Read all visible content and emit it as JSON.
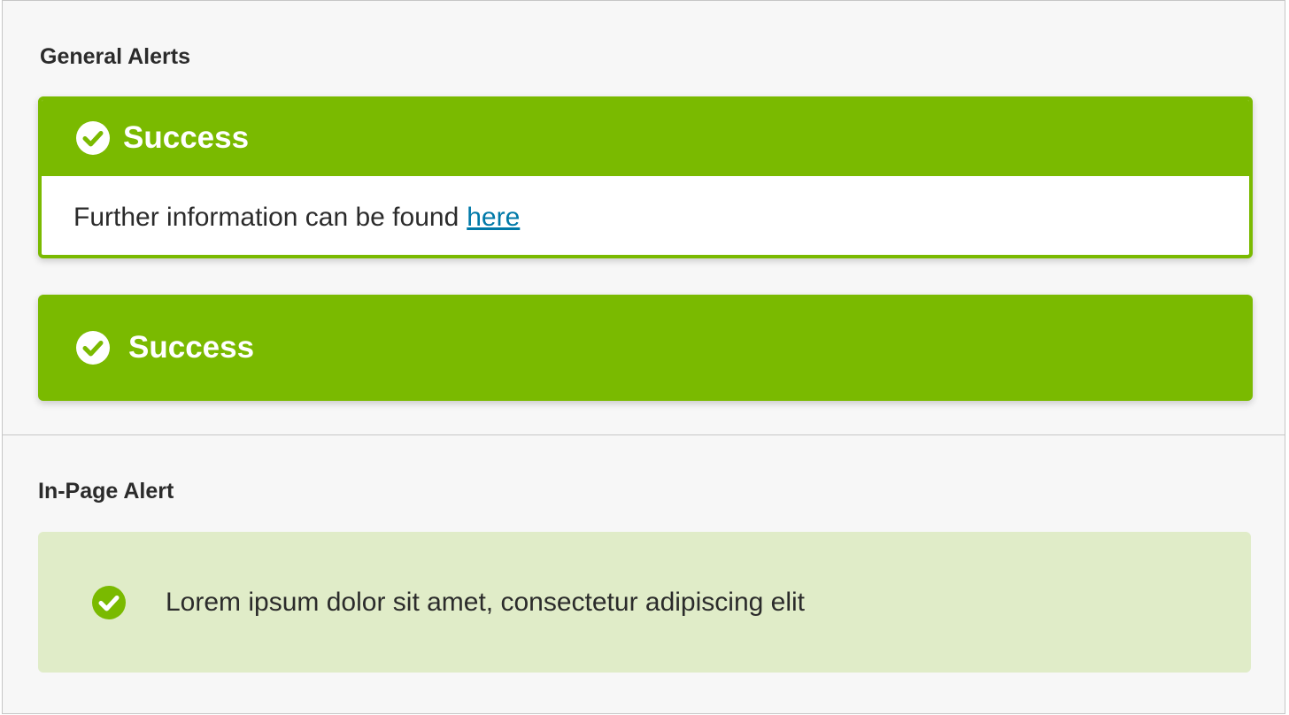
{
  "general": {
    "title": "General Alerts",
    "alert_with_body": {
      "heading": "Success",
      "message": "Further information can be found",
      "link_label": "here"
    },
    "alert_compact": {
      "heading": "Success"
    }
  },
  "inpage": {
    "title": "In-Page Alert",
    "message": "Lorem ipsum dolor sit amet, consectetur adipiscing elit"
  },
  "colors": {
    "success_green": "#7aba00",
    "inpage_background": "#e0ecc8",
    "link": "#0079a8",
    "panel_background": "#f7f7f7"
  },
  "icons": {
    "alert_icon": "check-circle-icon"
  }
}
